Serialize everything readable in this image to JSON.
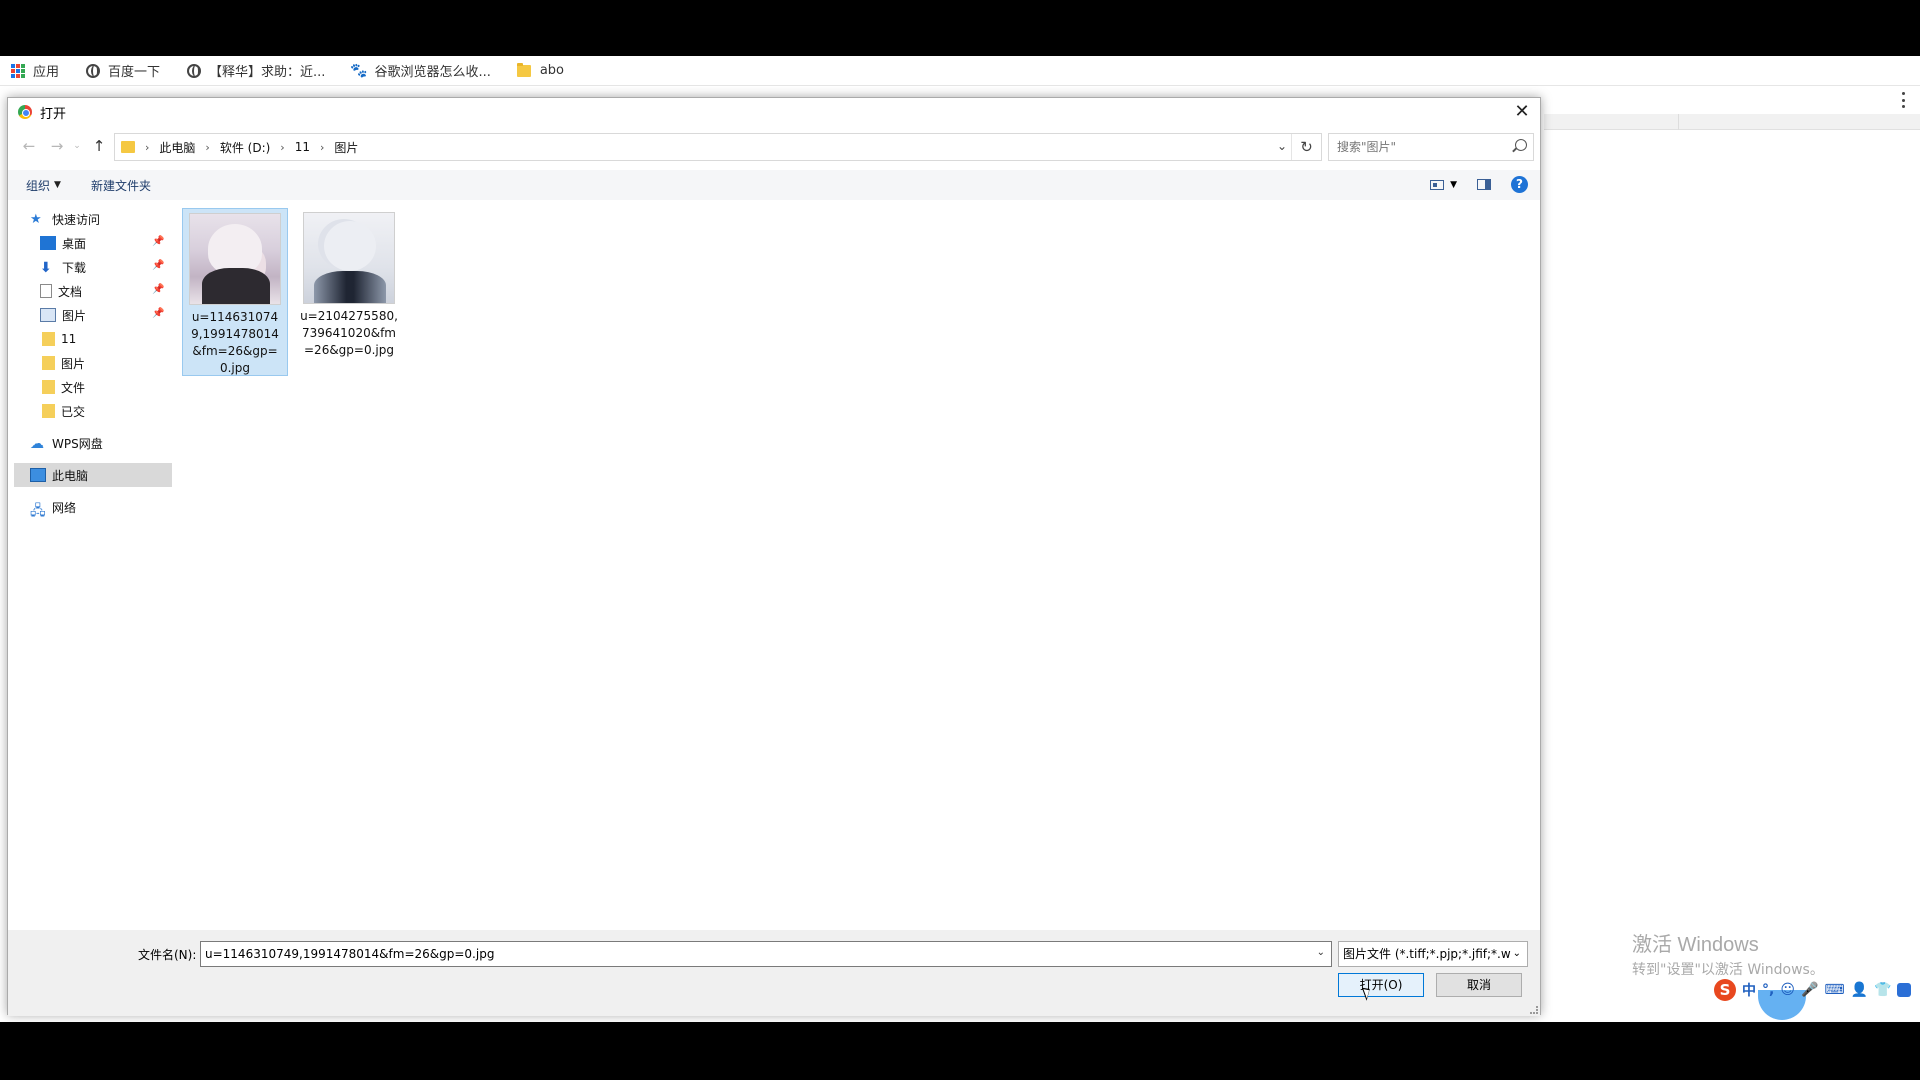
{
  "bookmarks": [
    {
      "label": "应用",
      "icon": "apps-grid-icon"
    },
    {
      "label": "百度一下",
      "icon": "globe-icon"
    },
    {
      "label": "【释华】求助：近...",
      "icon": "globe-icon"
    },
    {
      "label": "谷歌浏览器怎么收...",
      "icon": "baidu-paw-icon"
    },
    {
      "label": "abo",
      "icon": "folder-icon"
    }
  ],
  "dialog": {
    "title": "打开",
    "breadcrumb": [
      "此电脑",
      "软件 (D:)",
      "11",
      "图片"
    ],
    "search_placeholder": "搜索\"图片\"",
    "toolbar": {
      "organize": "组织",
      "new_folder": "新建文件夹"
    },
    "sidebar": {
      "quick_access": "快速访问",
      "pinned": [
        "桌面",
        "下载",
        "文档",
        "图片"
      ],
      "folders": [
        "11",
        "图片",
        "文件",
        "已交"
      ],
      "wps": "WPS网盘",
      "this_pc": "此电脑",
      "network": "网络"
    },
    "files": [
      {
        "name": "u=1146310749,1991478014&fm=26&gp=0.jpg",
        "selected": true
      },
      {
        "name": "u=2104275580,739641020&fm=26&gp=0.jpg",
        "selected": false
      }
    ],
    "filename_label": "文件名(N):",
    "filename_value": "u=1146310749,1991478014&fm=26&gp=0.jpg",
    "filetype_value": "图片文件 (*.tiff;*.pjp;*.jfif;*.wel",
    "open_button": "打开(O)",
    "cancel_button": "取消"
  },
  "watermark": {
    "title": "激活 Windows",
    "subtitle": "转到\"设置\"以激活 Windows。"
  },
  "ime": {
    "mode": "中"
  },
  "colors": {
    "accent": "#0078d7",
    "selection": "#cce4f7",
    "folder": "#f5c842"
  }
}
